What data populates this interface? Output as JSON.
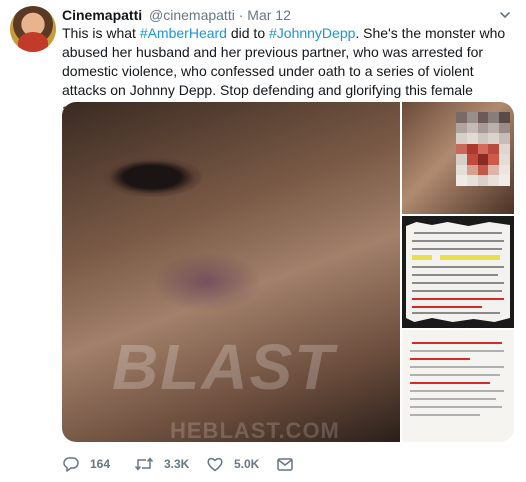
{
  "tweet": {
    "author_name": "Cinemapatti",
    "author_handle": "@cinemapatti",
    "separator": "·",
    "date": "Mar 12",
    "text_parts": [
      {
        "type": "text",
        "value": "This is what "
      },
      {
        "type": "hashtag",
        "value": "#AmberHeard"
      },
      {
        "type": "text",
        "value": " did to "
      },
      {
        "type": "hashtag",
        "value": "#JohnnyDepp"
      },
      {
        "type": "text",
        "value": ". She's the monster who abused her husband and her previous partner, who was arrested for domestic violence, who confessed under oath to a series of violent attacks on Johnny Depp. Stop defending and glorifying this female abuser!"
      }
    ]
  },
  "media": {
    "watermark": "BLAST",
    "watermark_sub": "HEBLAST.COM"
  },
  "actions": {
    "reply_count": "164",
    "retweet_count": "3.3K",
    "like_count": "5.0K"
  },
  "colors": {
    "link": "#1b95e0",
    "secondary_text": "#657786",
    "primary_text": "#14171a"
  },
  "icons": {
    "reply": "reply-icon",
    "retweet": "retweet-icon",
    "like": "heart-icon",
    "message": "direct-message-icon",
    "more": "chevron-down-icon"
  }
}
